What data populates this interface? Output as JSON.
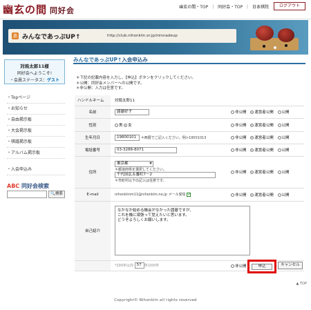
{
  "header": {
    "logo_main": "幽玄の間",
    "logo_sub": "同好会",
    "links": [
      "幽玄の間・TOP",
      "｜",
      "同好会・TOP",
      "｜",
      "日本棋院"
    ],
    "logout_label": "ログアウト"
  },
  "banner": {
    "icon_label": "あ",
    "title": "みんなであっぷUP↑",
    "url": "http://club.nihonkiin.or.jp/minnadeup"
  },
  "sidebar": {
    "user_name": "対局太郎11様",
    "welcome": "同好会へようこそ!",
    "status_label": "会員ステータス：",
    "status_value": "ゲスト",
    "menu": [
      "Topページ",
      "お知らせ",
      "自由掲示板",
      "大会掲示板",
      "棋譜掲示板",
      "アルバム掲示板"
    ],
    "menu_join": "入会申込み",
    "search_title": "同好会検索",
    "search_logo": "ABC",
    "search_button": "検索"
  },
  "main": {
    "group_name": "みんなであっぷUP↑",
    "page_title": "入会申込み",
    "notes": [
      "＊下記の記載内容を入力し、【申込】ボタンをクリックしてください。",
      "＊公開：同好会メンバーへの公開です。",
      "＊非公開：入力は任意です。"
    ],
    "publicity_options": [
      "非公開",
      "運営者公開",
      "公開"
    ],
    "form": {
      "handle_label": "ハンドルネーム",
      "handle_value": "対局太郎11",
      "name_label": "名前",
      "name_value": "囲碁好子",
      "gender_label": "性別",
      "gender_male": "男",
      "gender_female": "女",
      "birthday_label": "生年月日",
      "birthday_value": "19800101",
      "birthday_hint": "＊西暦でご記入ください。例>19501013",
      "phone_label": "電話番号",
      "phone_value": "03-3288-8071",
      "address_label": "住所",
      "prefecture_value": "東京都",
      "prefecture_hint": "＊都道府県を選択してください。",
      "address_value": "千代田区五番町7－2",
      "address_hint": "＊市町村以下の記入は任意です。",
      "email_label": "E-mail",
      "email_value": "nihonkiinm11@nihonkiin.ne.jp",
      "email_receive_label": "メール受信",
      "intro_label": "自己紹介",
      "intro_value": "なかなか始める機会がなかった囲碁ですが、\nこれを機に頑張って覚えたいと思います。\nどうぞよろしくお願いします。",
      "char_limit_prefix": "*200字以内 ",
      "char_count": "57",
      "char_limit_suffix": "字/200字"
    },
    "submit_label": "申込",
    "cancel_label": "キャンセル"
  },
  "totop_label": "▲ TOP",
  "footer": "Copyright© Nihonkiin all rights reserved",
  "colors": {
    "brand": "#8a1a22",
    "accent": "#2a6ea0",
    "highlight": "#e00000"
  }
}
